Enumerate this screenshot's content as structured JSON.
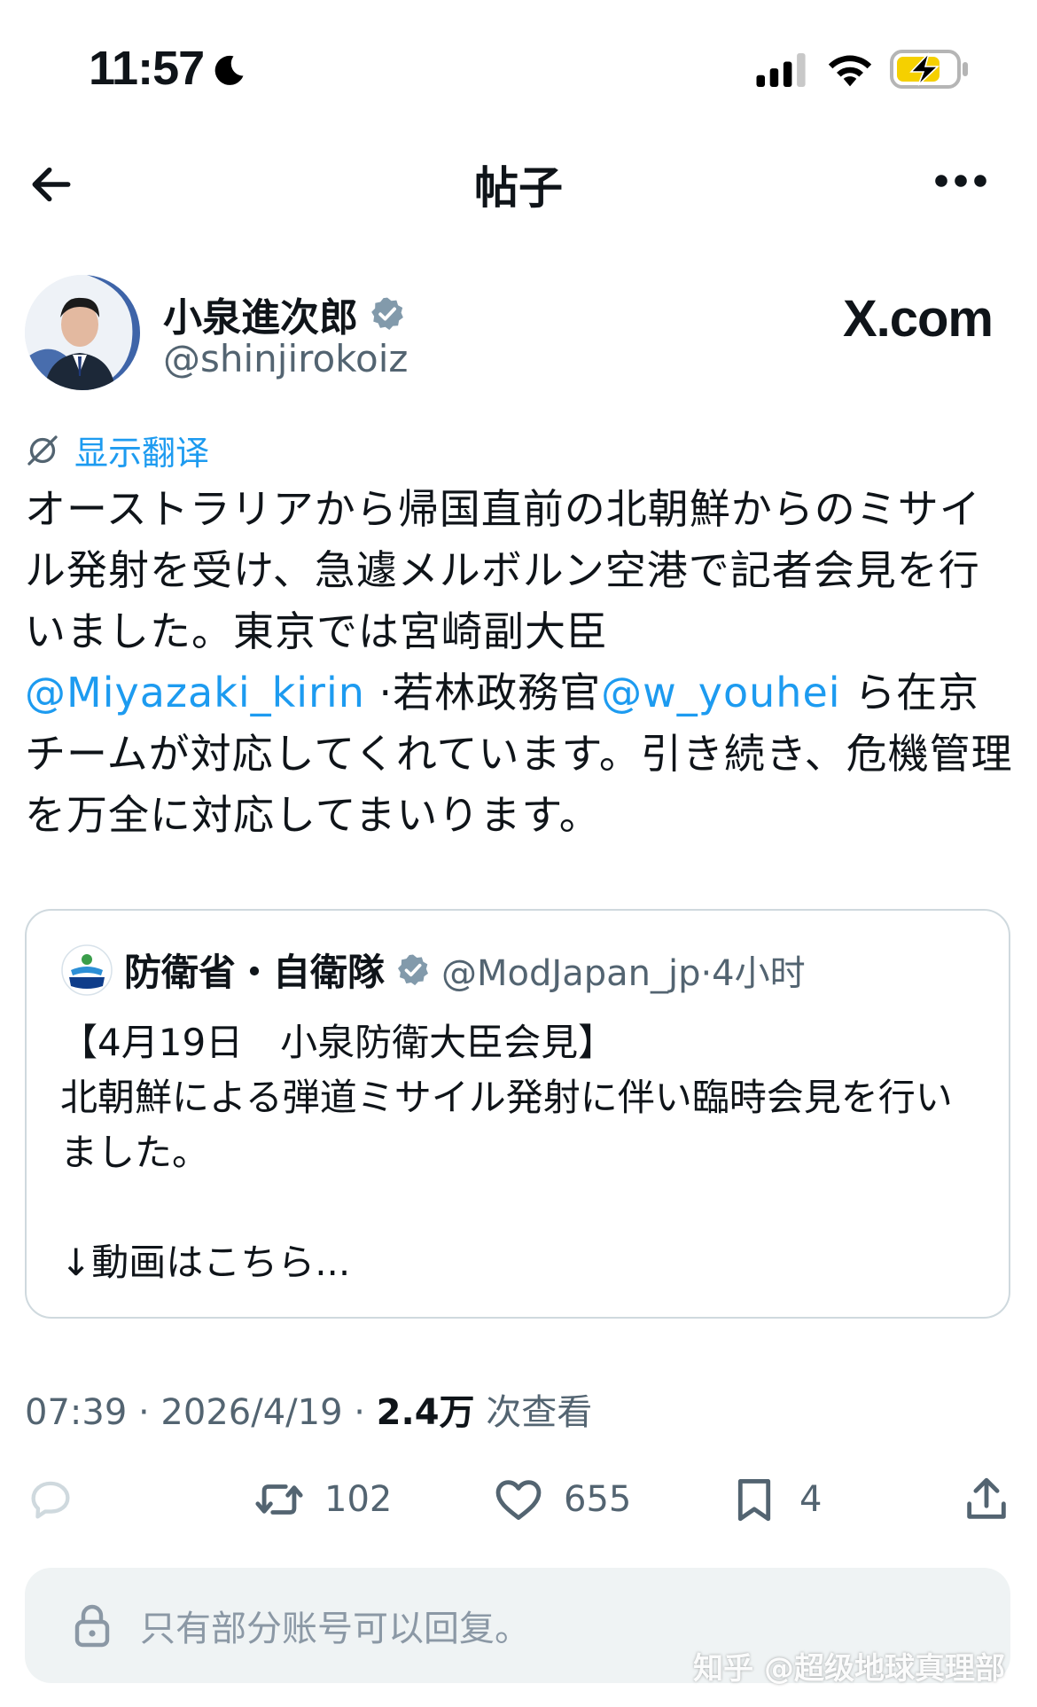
{
  "status_bar": {
    "time": "11:57"
  },
  "nav": {
    "title": "帖子"
  },
  "author": {
    "name": "小泉進次郎",
    "handle": "@shinjirokoiz",
    "verified": true
  },
  "brand": {
    "logo_text": "X.com"
  },
  "translate": {
    "label": "显示翻译"
  },
  "post": {
    "text_part1": "オーストラリアから帰国直前の北朝鮮からのミサイル発射を受け、急遽メルボルン空港で記者会見を行いました。東京では宮崎副大臣",
    "mention1": "@Miyazaki_kirin",
    "text_part2": "·若林政務官",
    "mention2": "@w_youhei",
    "text_part3": "ら在京チームが対応してくれています。引き続き、危機管理を万全に対応してまいります。"
  },
  "quote": {
    "name": "防衛省・自衛隊",
    "handle_time": "@ModJapan_jp·4小时",
    "logo_label": "防衛省",
    "body": "【4月19日　小泉防衛大臣会見】\n北朝鮮による弾道ミサイル発射に伴い臨時会見を行いました。\n\n↓動画はこちら..."
  },
  "meta": {
    "time_date": "07:39 · 2026/4/19 · ",
    "views_count": "2.4万",
    "views_label": " 次查看"
  },
  "actions": {
    "retweets": "102",
    "likes": "655",
    "bookmarks": "4"
  },
  "reply_restriction": {
    "text": "只有部分账号可以回复。"
  },
  "watermark": {
    "text": "知乎 @超级地球真理部"
  },
  "colors": {
    "accent": "#1d9bf0",
    "secondary_text": "#536471",
    "border": "#cfd9de",
    "battery_charge": "#f5d000"
  }
}
